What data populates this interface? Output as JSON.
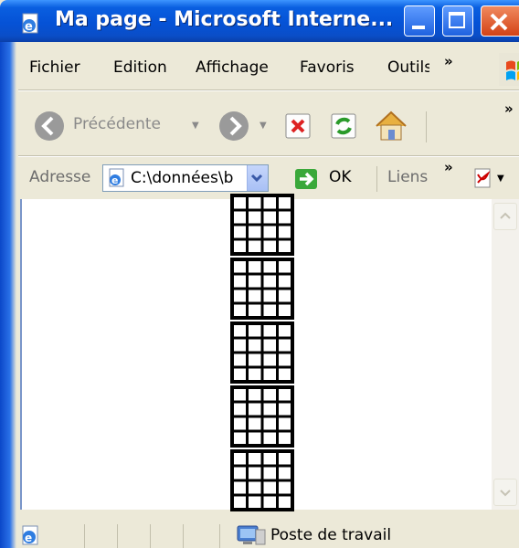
{
  "window": {
    "title": "Ma page - Microsoft Interne...",
    "controls": [
      "minimize",
      "maximize",
      "close"
    ]
  },
  "menu": {
    "items": [
      "Fichier",
      "Edition",
      "Affichage",
      "Favoris",
      "Outils"
    ],
    "overflow": "»"
  },
  "toolbar": {
    "back_label": "Précédente",
    "overflow": "»",
    "icons": [
      "back-arrow-icon",
      "forward-arrow-icon",
      "stop-icon",
      "refresh-icon",
      "home-icon"
    ]
  },
  "address": {
    "label": "Adresse",
    "value": "C:\\données\\b",
    "go_label": "OK",
    "links_label": "Liens",
    "overflow": "»"
  },
  "content": {
    "image_blocks": 5
  },
  "status": {
    "zone_text": "Poste de travail"
  },
  "colors": {
    "titlebar": "#0552d6",
    "close": "#d44216",
    "chrome": "#ece9d8"
  }
}
